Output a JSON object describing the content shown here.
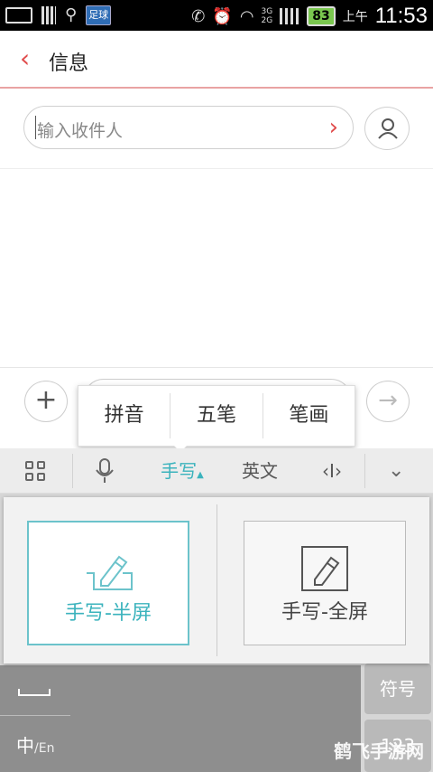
{
  "status_bar": {
    "app_badge": "足球",
    "network": [
      "3G",
      "2G"
    ],
    "battery": "83",
    "ampm": "上午",
    "time": "11:53"
  },
  "header": {
    "back_icon": "chevron-left-icon",
    "title": "信息"
  },
  "recipient": {
    "placeholder": "输入收件人"
  },
  "ime_popup": {
    "options": [
      "拼音",
      "五笔",
      "笔画"
    ]
  },
  "keyboard_toolbar": {
    "handwrite": "手写",
    "english": "英文"
  },
  "handwrite_panel": {
    "half_label": "手写-半屏",
    "full_label": "手写-全屏"
  },
  "keys": {
    "lang_main": "中",
    "lang_sub": "/En",
    "symbols": "符号",
    "numbers": "123"
  },
  "watermark": "鹤飞手游网",
  "colors": {
    "accent": "#3bb3bd",
    "brand_red": "#e04b4b"
  }
}
